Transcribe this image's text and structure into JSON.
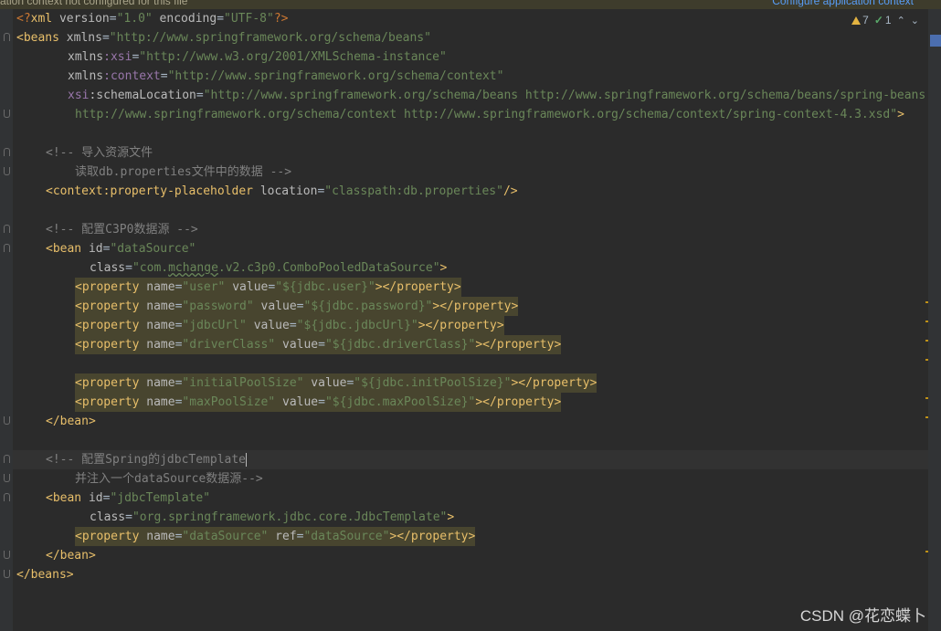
{
  "banner": {
    "message": "ation context not configured for this file",
    "action": "Configure application context"
  },
  "inspection": {
    "warnings": "7",
    "weak_warnings": "1",
    "prev": "⌃",
    "next": "⌄"
  },
  "code": {
    "l01": {
      "a": "<?",
      "b": "xml ",
      "c": "version",
      "d": "=",
      "e": "\"1.0\"",
      "f": " encoding",
      "g": "=",
      "h": "\"UTF-8\"",
      "i": "?>"
    },
    "l02": {
      "a": "<beans ",
      "b": "xmlns",
      "c": "=",
      "d": "\"http://www.springframework.org/schema/beans\""
    },
    "l03": {
      "a": "xmlns",
      "b": ":xsi",
      "c": "=",
      "d": "\"http://www.w3.org/2001/XMLSchema-instance\""
    },
    "l04": {
      "a": "xmlns",
      "b": ":context",
      "c": "=",
      "d": "\"http://www.springframework.org/schema/context\""
    },
    "l05": {
      "a": "xsi",
      "b": ":schemaLocation",
      "c": "=",
      "d": "\"http://www.springframework.org/schema/beans http://www.springframework.org/schema/beans/spring-beans.xsd"
    },
    "l06": {
      "a": "http://www.springframework.org/schema/context http://www.springframework.org/schema/context/spring-context-4.3.xsd\"",
      "b": ">"
    },
    "l08": "<!-- 导入资源文件",
    "l09": "读取db.properties文件中的数据 -->",
    "l10": {
      "a": "<context",
      "b": ":property-placeholder ",
      "c": "location",
      "d": "=",
      "e": "\"classpath:db.properties\"",
      "f": "/>"
    },
    "l12": "<!-- 配置C3P0数据源 -->",
    "l13": {
      "a": "<bean ",
      "b": "id",
      "c": "=",
      "d": "\"dataSource\""
    },
    "l14": {
      "a": "class",
      "b": "=",
      "c": "\"com.",
      "d": "mchange",
      "e": ".v2.c3p0.ComboPooledDataSource\"",
      "f": ">"
    },
    "props1": [
      {
        "name_attr": "name",
        "eq": "=",
        "name": "\"user\"",
        "value_attr": " value",
        "eq2": "=",
        "value": "\"${jdbc.user}\""
      },
      {
        "name_attr": "name",
        "eq": "=",
        "name": "\"password\"",
        "value_attr": " value",
        "eq2": "=",
        "value": "\"${jdbc.password}\""
      },
      {
        "name_attr": "name",
        "eq": "=",
        "name": "\"jdbcUrl\"",
        "value_attr": " value",
        "eq2": "=",
        "value": "\"${jdbc.jdbcUrl}\""
      },
      {
        "name_attr": "name",
        "eq": "=",
        "name": "\"driverClass\"",
        "value_attr": " value",
        "eq2": "=",
        "value": "\"${jdbc.driverClass}\""
      },
      {
        "name_attr": "name",
        "eq": "=",
        "name": "\"initialPoolSize\"",
        "value_attr": " value",
        "eq2": "=",
        "value": "\"${jdbc.initPoolSize}\""
      },
      {
        "name_attr": "name",
        "eq": "=",
        "name": "\"maxPoolSize\"",
        "value_attr": " value",
        "eq2": "=",
        "value": "\"${jdbc.maxPoolSize}\""
      }
    ],
    "prop_open": "<property ",
    "prop_close_open": "></property",
    "prop_close_end": ">",
    "bean_end": "</bean>",
    "l24": "<!-- 配置Spring的jdbcTemplate",
    "l25": "并注入一个dataSource数据源-->",
    "l26": {
      "a": "<bean ",
      "b": "id",
      "c": "=",
      "d": "\"jdbcTemplate\""
    },
    "l27": {
      "a": "class",
      "b": "=",
      "c": "\"org.springframework.jdbc.core.JdbcTemplate\"",
      "d": ">"
    },
    "l28": {
      "a": "<property ",
      "b": "name",
      "c": "=",
      "d": "\"dataSource\"",
      "e": " ref",
      "f": "=",
      "g": "\"dataSource\"",
      "h": "></property",
      "i": ">"
    },
    "l30": "</beans>"
  },
  "watermark": "CSDN @花恋蝶卜"
}
